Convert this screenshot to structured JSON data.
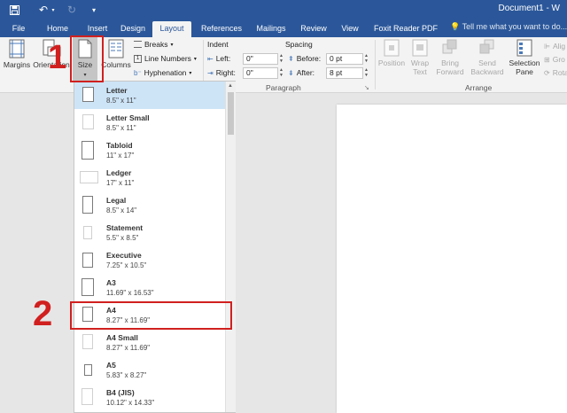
{
  "titlebar": {
    "document_title": "Document1 - W"
  },
  "tabs": [
    "File",
    "Home",
    "Insert",
    "Design",
    "Layout",
    "References",
    "Mailings",
    "Review",
    "View",
    "Foxit Reader PDF"
  ],
  "tell_me": "Tell me what you want to do...",
  "ribbon": {
    "margins": "Margins",
    "orientation": "Orientation",
    "size": "Size",
    "columns": "Columns",
    "breaks": "Breaks",
    "line_numbers": "Line Numbers",
    "hyphenation": "Hyphenation",
    "indent_label": "Indent",
    "indent_left_label": "Left:",
    "indent_left_value": "0\"",
    "indent_right_label": "Right:",
    "indent_right_value": "0\"",
    "spacing_label": "Spacing",
    "spacing_before_label": "Before:",
    "spacing_before_value": "0 pt",
    "spacing_after_label": "After:",
    "spacing_after_value": "8 pt",
    "paragraph_group": "Paragraph",
    "position": "Position",
    "wrap_text": [
      "Wrap",
      "Text"
    ],
    "bring_forward": [
      "Bring",
      "Forward"
    ],
    "send_backward": [
      "Send",
      "Backward"
    ],
    "selection_pane": [
      "Selection",
      "Pane"
    ],
    "arrange_group": "Arrange",
    "align": "Alig",
    "group": "Gro",
    "rotate": "Rota"
  },
  "size_menu": [
    {
      "name": "Letter",
      "dim": "8.5\" x 11\""
    },
    {
      "name": "Letter Small",
      "dim": "8.5\" x 11\""
    },
    {
      "name": "Tabloid",
      "dim": "11\" x 17\""
    },
    {
      "name": "Ledger",
      "dim": "17\" x 11\""
    },
    {
      "name": "Legal",
      "dim": "8.5\" x 14\""
    },
    {
      "name": "Statement",
      "dim": "5.5\" x 8.5\""
    },
    {
      "name": "Executive",
      "dim": "7.25\" x 10.5\""
    },
    {
      "name": "A3",
      "dim": "11.69\" x 16.53\""
    },
    {
      "name": "A4",
      "dim": "8.27\" x 11.69\""
    },
    {
      "name": "A4 Small",
      "dim": "8.27\" x 11.69\""
    },
    {
      "name": "A5",
      "dim": "5.83\" x 8.27\""
    },
    {
      "name": "B4 (JIS)",
      "dim": "10.12\" x 14.33\""
    }
  ],
  "annotations": {
    "step1": "1",
    "step2": "2"
  },
  "colors": {
    "title_bar": "#2b579a",
    "ribbon": "#f3f3f3",
    "highlight": "#d0201f",
    "selected_item": "#cde4f7"
  }
}
